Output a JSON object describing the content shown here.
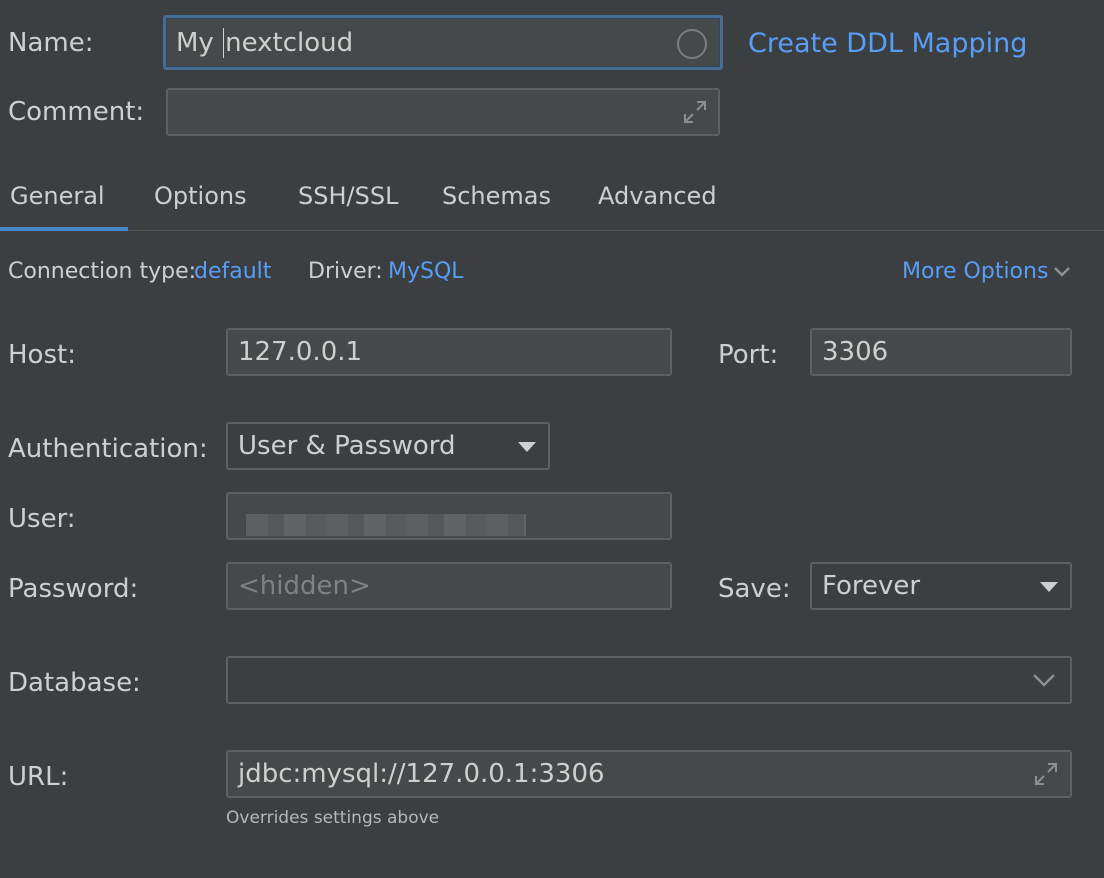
{
  "form": {
    "name_label": "Name:",
    "name_prefix": "My ",
    "name_suffix": "nextcloud",
    "create_ddl_link": "Create DDL Mapping",
    "comment_label": "Comment:",
    "comment_value": ""
  },
  "tabs": [
    {
      "label": "General",
      "active": true
    },
    {
      "label": "Options",
      "active": false
    },
    {
      "label": "SSH/SSL",
      "active": false
    },
    {
      "label": "Schemas",
      "active": false
    },
    {
      "label": "Advanced",
      "active": false
    }
  ],
  "general": {
    "connection_type_label": "Connection type:",
    "connection_type_value": "default",
    "driver_label": "Driver:",
    "driver_value": "MySQL",
    "more_options": "More Options",
    "host_label": "Host:",
    "host_value": "127.0.0.1",
    "port_label": "Port:",
    "port_value": "3306",
    "auth_label": "Authentication:",
    "auth_value": "User & Password",
    "user_label": "User:",
    "password_label": "Password:",
    "password_placeholder": "<hidden>",
    "save_label": "Save:",
    "save_value": "Forever",
    "database_label": "Database:",
    "database_value": "",
    "url_label": "URL:",
    "url_value": "jdbc:mysql://127.0.0.1:3306",
    "url_hint": "Overrides settings above"
  },
  "colors": {
    "background": "#3c3f41",
    "field_background": "#45494a",
    "link": "#589df6",
    "active_tab_underline": "#4a88c7"
  }
}
